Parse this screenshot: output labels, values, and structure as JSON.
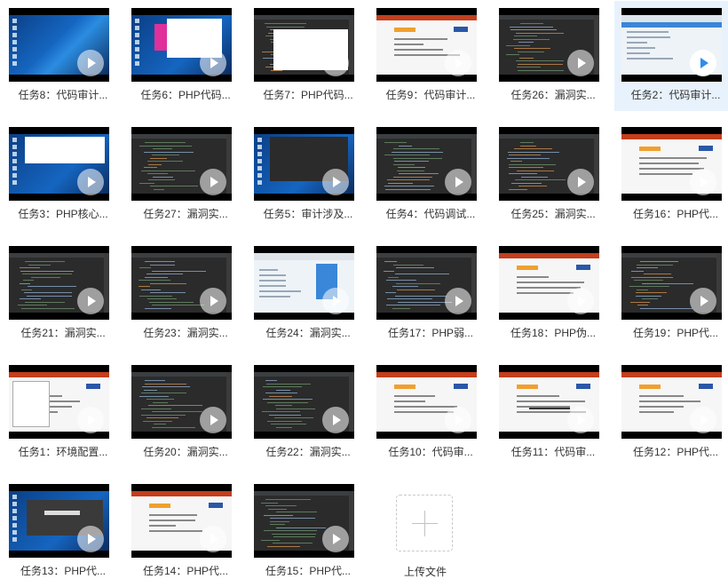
{
  "files": [
    {
      "name": "任务8：代码审计...",
      "thumb": "windows-desktop",
      "selected": false
    },
    {
      "name": "任务6：PHP代码...",
      "thumb": "windows-desktop-app",
      "selected": false
    },
    {
      "name": "任务7：PHP代码...",
      "thumb": "code-editor-dialog",
      "selected": false
    },
    {
      "name": "任务9：代码审计...",
      "thumb": "slide",
      "selected": false
    },
    {
      "name": "任务26：漏洞实...",
      "thumb": "code-editor",
      "selected": false
    },
    {
      "name": "任务2：代码审计...",
      "thumb": "browser",
      "selected": true
    },
    {
      "name": "任务3：PHP核心...",
      "thumb": "windows-desktop-window",
      "selected": false
    },
    {
      "name": "任务27：漏洞实...",
      "thumb": "code-editor",
      "selected": false
    },
    {
      "name": "任务5：审计涉及...",
      "thumb": "windows-desktop-code",
      "selected": false
    },
    {
      "name": "任务4：代码调试...",
      "thumb": "code-editor",
      "selected": false
    },
    {
      "name": "任务25：漏洞实...",
      "thumb": "code-editor",
      "selected": false
    },
    {
      "name": "任务16：PHP代...",
      "thumb": "slide",
      "selected": false
    },
    {
      "name": "任务21：漏洞实...",
      "thumb": "code-editor",
      "selected": false
    },
    {
      "name": "任务23：漏洞实...",
      "thumb": "code-editor",
      "selected": false
    },
    {
      "name": "任务24：漏洞实...",
      "thumb": "browser-panel",
      "selected": false
    },
    {
      "name": "任务17：PHP弱...",
      "thumb": "code-editor",
      "selected": false
    },
    {
      "name": "任务18：PHP伪...",
      "thumb": "slide",
      "selected": false
    },
    {
      "name": "任务19：PHP代...",
      "thumb": "code-editor",
      "selected": false
    },
    {
      "name": "任务1：环境配置...",
      "thumb": "slide-window",
      "selected": false
    },
    {
      "name": "任务20：漏洞实...",
      "thumb": "code-editor",
      "selected": false
    },
    {
      "name": "任务22：漏洞实...",
      "thumb": "code-editor",
      "selected": false
    },
    {
      "name": "任务10：代码审...",
      "thumb": "slide",
      "selected": false
    },
    {
      "name": "任务11：代码审...",
      "thumb": "slide-diagram",
      "selected": false
    },
    {
      "name": "任务12：PHP代...",
      "thumb": "slide",
      "selected": false
    },
    {
      "name": "任务13：PHP代...",
      "thumb": "windows-desktop-dark",
      "selected": false
    },
    {
      "name": "任务14：PHP代...",
      "thumb": "slide",
      "selected": false
    },
    {
      "name": "任务15：PHP代...",
      "thumb": "code-editor",
      "selected": false
    }
  ],
  "upload": {
    "label": "上传文件",
    "icon": "plus-icon"
  },
  "colors": {
    "accent": "#2d8cf0",
    "selected_bg": "#e8f2fc"
  }
}
